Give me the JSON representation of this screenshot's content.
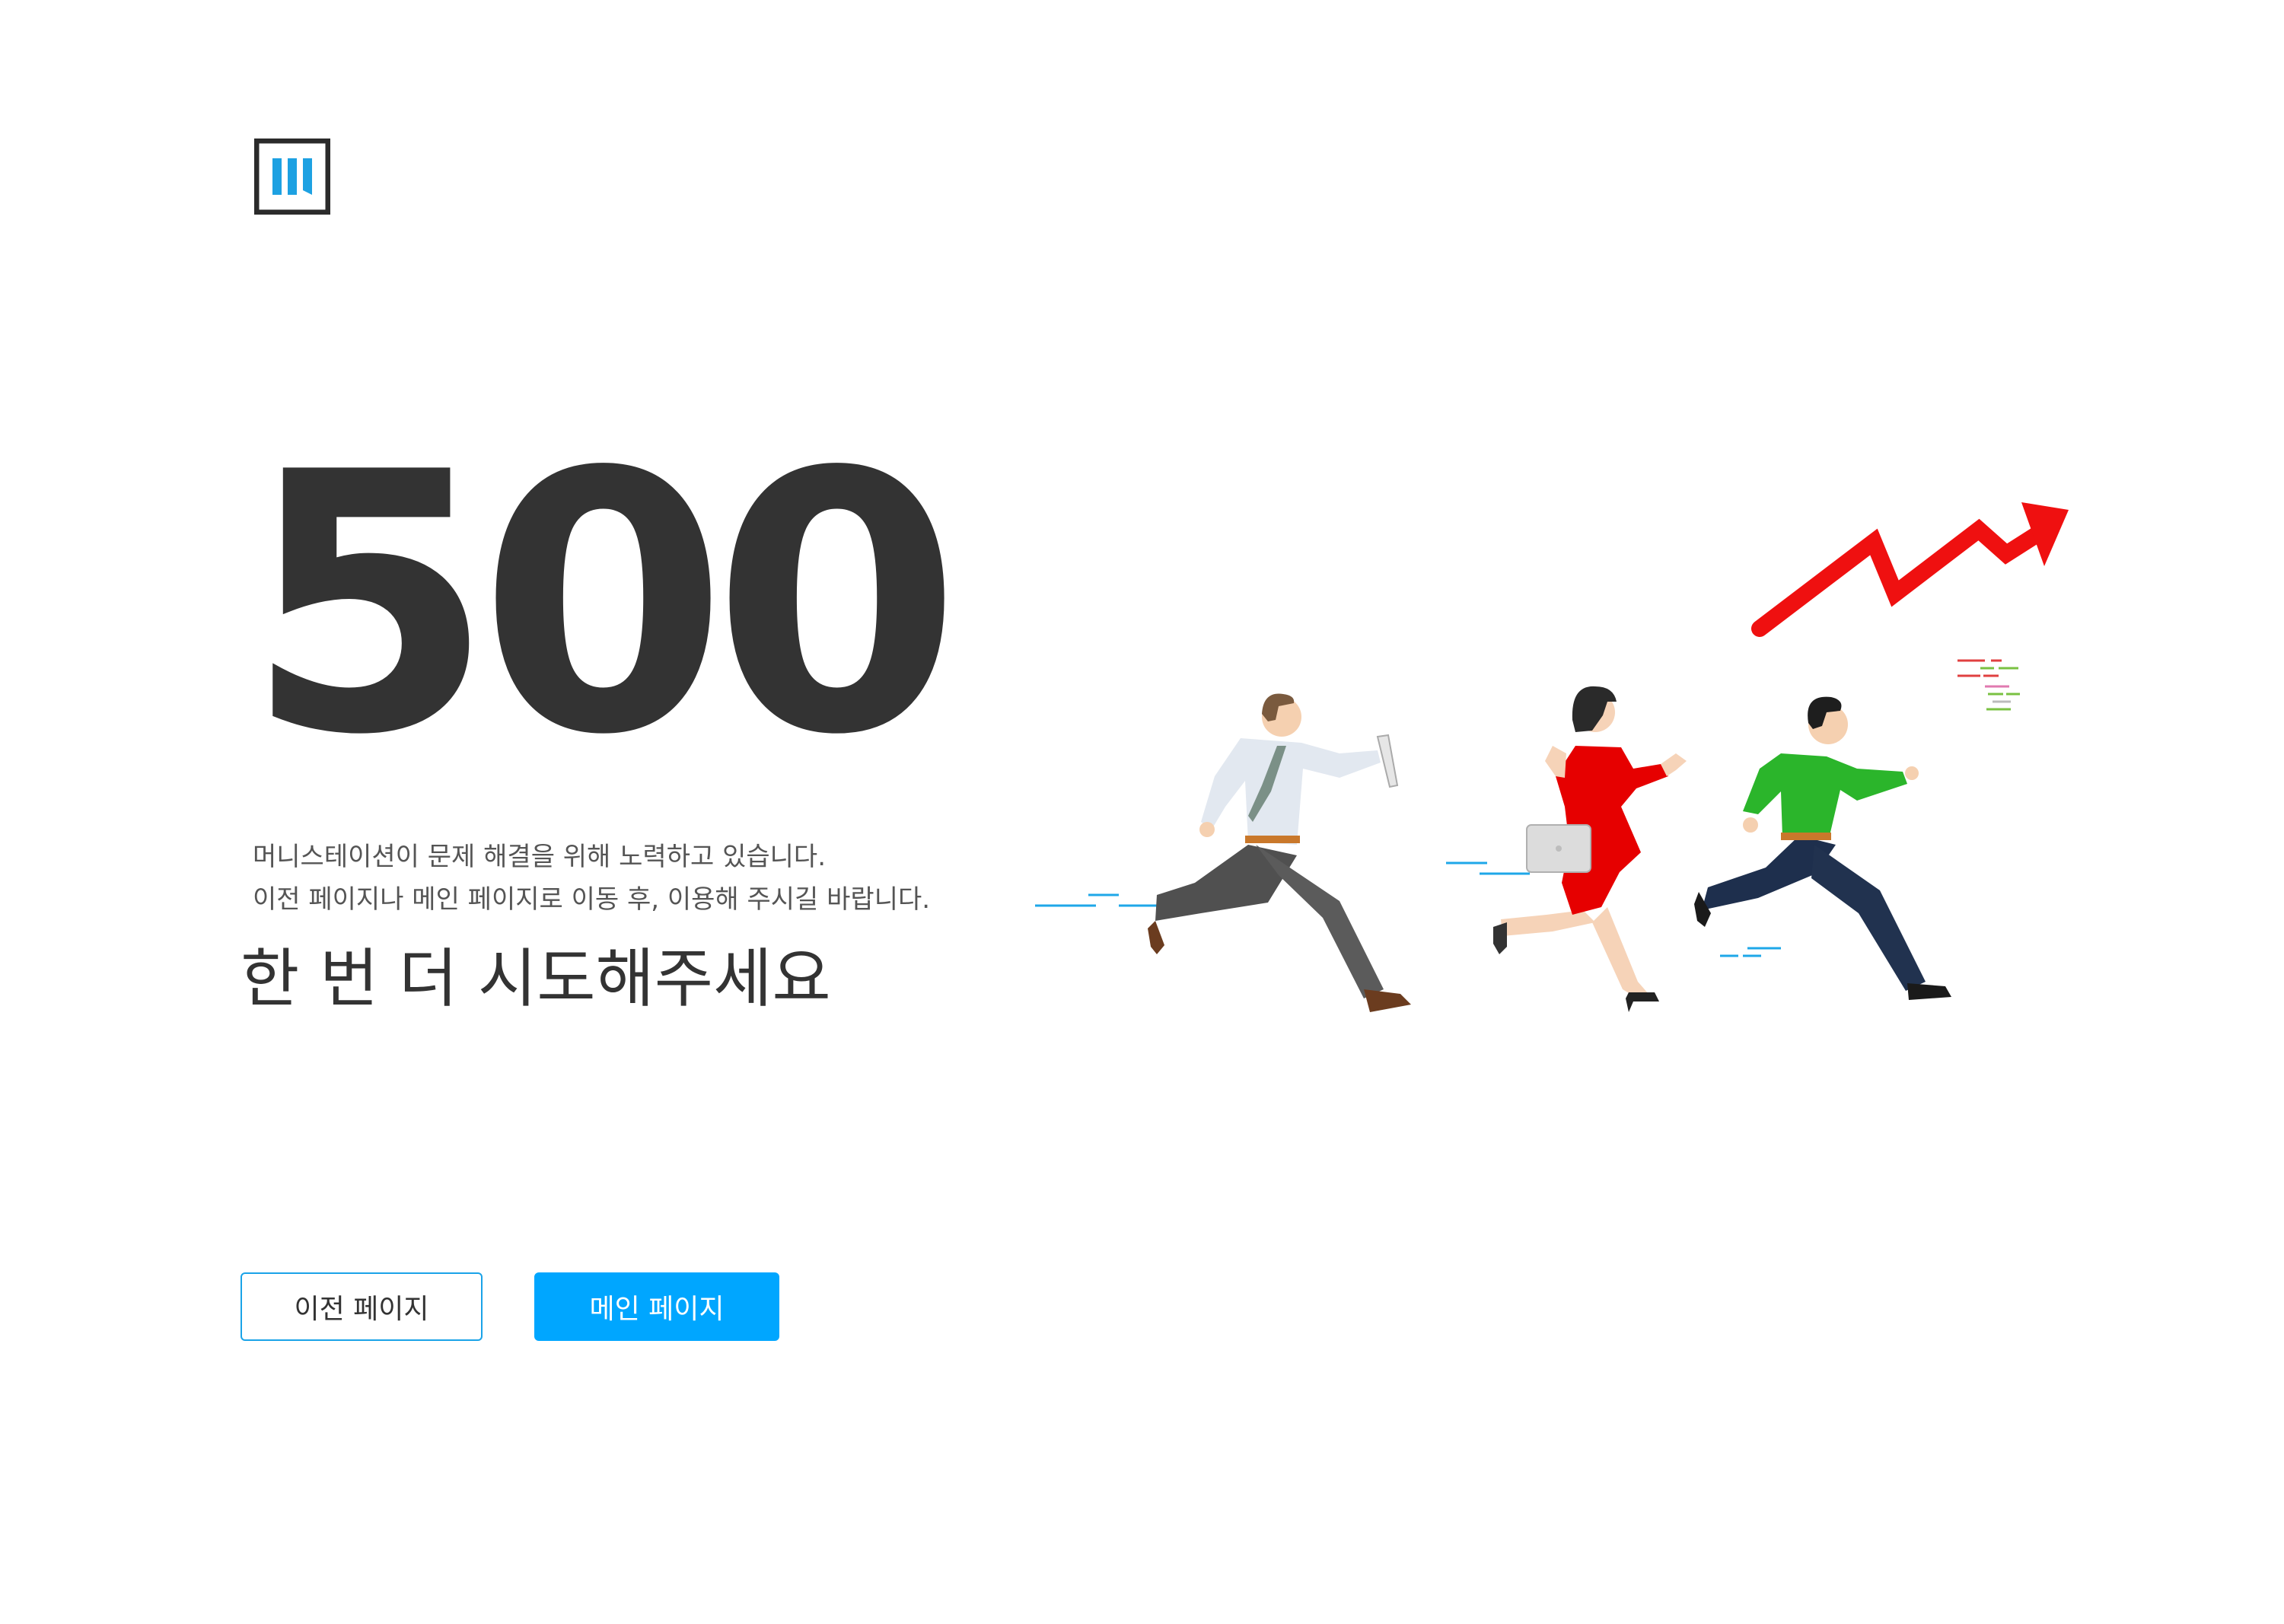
{
  "brand": {
    "logo_icon": "brand-logo-icon",
    "logo_color": "#1da1e2",
    "frame_color": "#2b2b2b"
  },
  "error": {
    "code": "500",
    "message_line_1": "머니스테이션이 문제 해결을 위해 노력하고 있습니다.",
    "message_line_2": "이전 페이지나 메인 페이지로 이동 후, 이용해 주시길 바랍니다.",
    "retry_text": "한 번 더 시도해주세요"
  },
  "actions": {
    "prev_label": "이전 페이지",
    "main_label": "메인 페이지"
  },
  "colors": {
    "accent": "#00a6ff",
    "text_dark": "#333333",
    "arrow_red": "#ef1010",
    "woman_dress": "#e60000",
    "runner_shirt": "#2bb52b"
  },
  "illustration": {
    "icon": "running-people-illustration",
    "arrow_icon": "trend-up-arrow-icon"
  }
}
